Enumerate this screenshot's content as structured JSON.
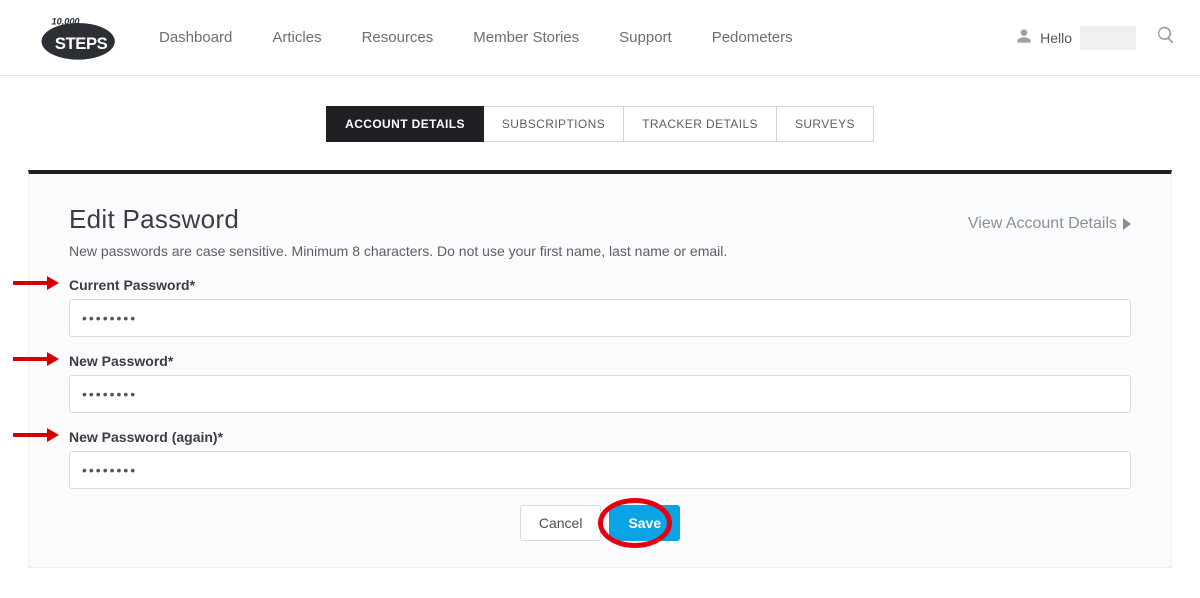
{
  "nav": {
    "items": [
      "Dashboard",
      "Articles",
      "Resources",
      "Member Stories",
      "Support",
      "Pedometers"
    ]
  },
  "user": {
    "greeting": "Hello"
  },
  "tabs": {
    "items": [
      "ACCOUNT DETAILS",
      "SUBSCRIPTIONS",
      "TRACKER DETAILS",
      "SURVEYS"
    ],
    "active_index": 0
  },
  "page": {
    "title": "Edit Password",
    "help": "New passwords are case sensitive. Minimum 8 characters. Do not use your first name, last name or email.",
    "view_account_link": "View Account Details"
  },
  "form": {
    "current_label": "Current Password*",
    "current_value": "••••••••",
    "new_label": "New Password*",
    "new_value": "••••••••",
    "again_label": "New Password (again)*",
    "again_value": "••••••••",
    "cancel": "Cancel",
    "save": "Save"
  }
}
